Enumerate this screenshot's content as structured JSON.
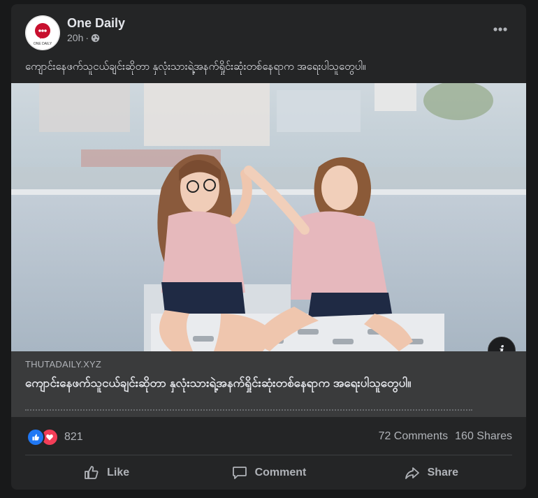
{
  "post": {
    "page_name": "One Daily",
    "time": "20h",
    "separator": "·",
    "caption": "ကျောင်းနေဖက်သူငယ်ချင်းဆိုတာ နှလုံးသားရဲ့အနက်ရှိုင်းဆုံးတစ်နေရာက အရေးပါသူတွေပါ။",
    "avatar_text": "ONE DAILY"
  },
  "link": {
    "domain": "THUTADAILY.XYZ",
    "title": "ကျောင်းနေဖက်သူငယ်ချင်းဆိုတာ နှလုံးသားရဲ့အနက်ရှိုင်းဆုံးတစ်နေရာက အရေးပါသူတွေပါ။"
  },
  "engagement": {
    "reaction_count": "821",
    "comments": "72 Comments",
    "shares": "160 Shares"
  },
  "actions": {
    "like": "Like",
    "comment": "Comment",
    "share": "Share"
  },
  "colors": {
    "card_bg": "#242526",
    "page_bg": "#18191a",
    "like_blue": "#2078f4",
    "love_red": "#f33e58"
  },
  "icons": [
    "globe-icon",
    "more-options-icon",
    "info-icon",
    "like-reaction-icon",
    "love-reaction-icon",
    "thumbs-up-icon",
    "comment-icon",
    "share-icon"
  ]
}
